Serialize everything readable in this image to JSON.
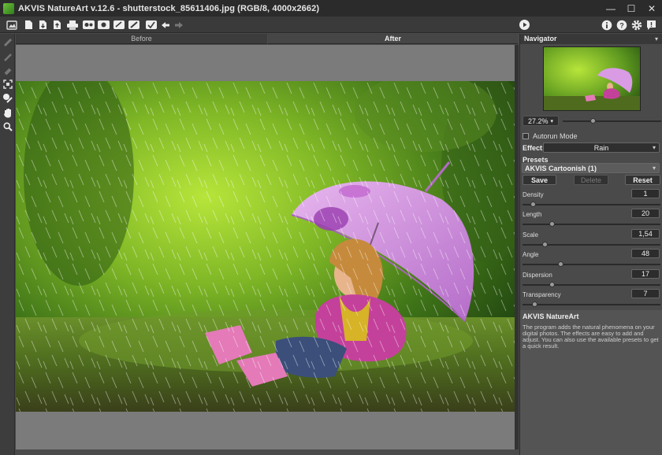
{
  "window": {
    "title": "AKVIS NatureArt v.12.6 - shutterstock_85611406.jpg (RGB/8, 4000x2662)",
    "controls": [
      "—",
      "☐",
      "✕"
    ]
  },
  "toolbar": {
    "left_icons": [
      "home-icon",
      "open-file-icon",
      "save-icon",
      "export-icon",
      "print-icon",
      "batch-icon",
      "plugin-icon",
      "edit-icon",
      "brush-icon",
      "check-icon",
      "undo-icon",
      "redo-icon"
    ],
    "right_icons": [
      "run-icon",
      "info-icon",
      "help-icon",
      "settings-icon",
      "notification-icon"
    ]
  },
  "tools": [
    "eraser-tool-icon",
    "brush-tool-icon",
    "history-tool-icon",
    "crop-tool-icon",
    "mask-tool-icon",
    "hand-tool-icon",
    "zoom-tool-icon"
  ],
  "tabs": {
    "before": "Before",
    "after": "After"
  },
  "navigator": {
    "title": "Navigator",
    "zoom": "27.2%",
    "zoom_level": 0.3
  },
  "settings": {
    "autorun_label": "Autorun Mode",
    "effect_label": "Effect:",
    "effect_value": "Rain",
    "presets_label": "Presets",
    "preset_value": "AKVIS Cartoonish (1)",
    "save_label": "Save",
    "delete_label": "Delete",
    "reset_label": "Reset"
  },
  "params": [
    {
      "label": "Density",
      "value": "1",
      "level": 0.06
    },
    {
      "label": "Length",
      "value": "20",
      "level": 0.2
    },
    {
      "label": "Scale",
      "value": "1,54",
      "level": 0.15
    },
    {
      "label": "Angle",
      "value": "48",
      "level": 0.27
    },
    {
      "label": "Dispersion",
      "value": "17",
      "level": 0.2
    },
    {
      "label": "Transparency",
      "value": "7",
      "level": 0.07
    }
  ],
  "about": {
    "title": "AKVIS NatureArt",
    "text": "The program adds the natural phenomena on your digital photos. The effects are easy to add and adjust. You can also use the available presets to get a quick result."
  },
  "colors": {
    "title_bar": "#2b2b2b",
    "panel": "#4a4a4a",
    "canvas_bg": "#7b7b7b"
  }
}
